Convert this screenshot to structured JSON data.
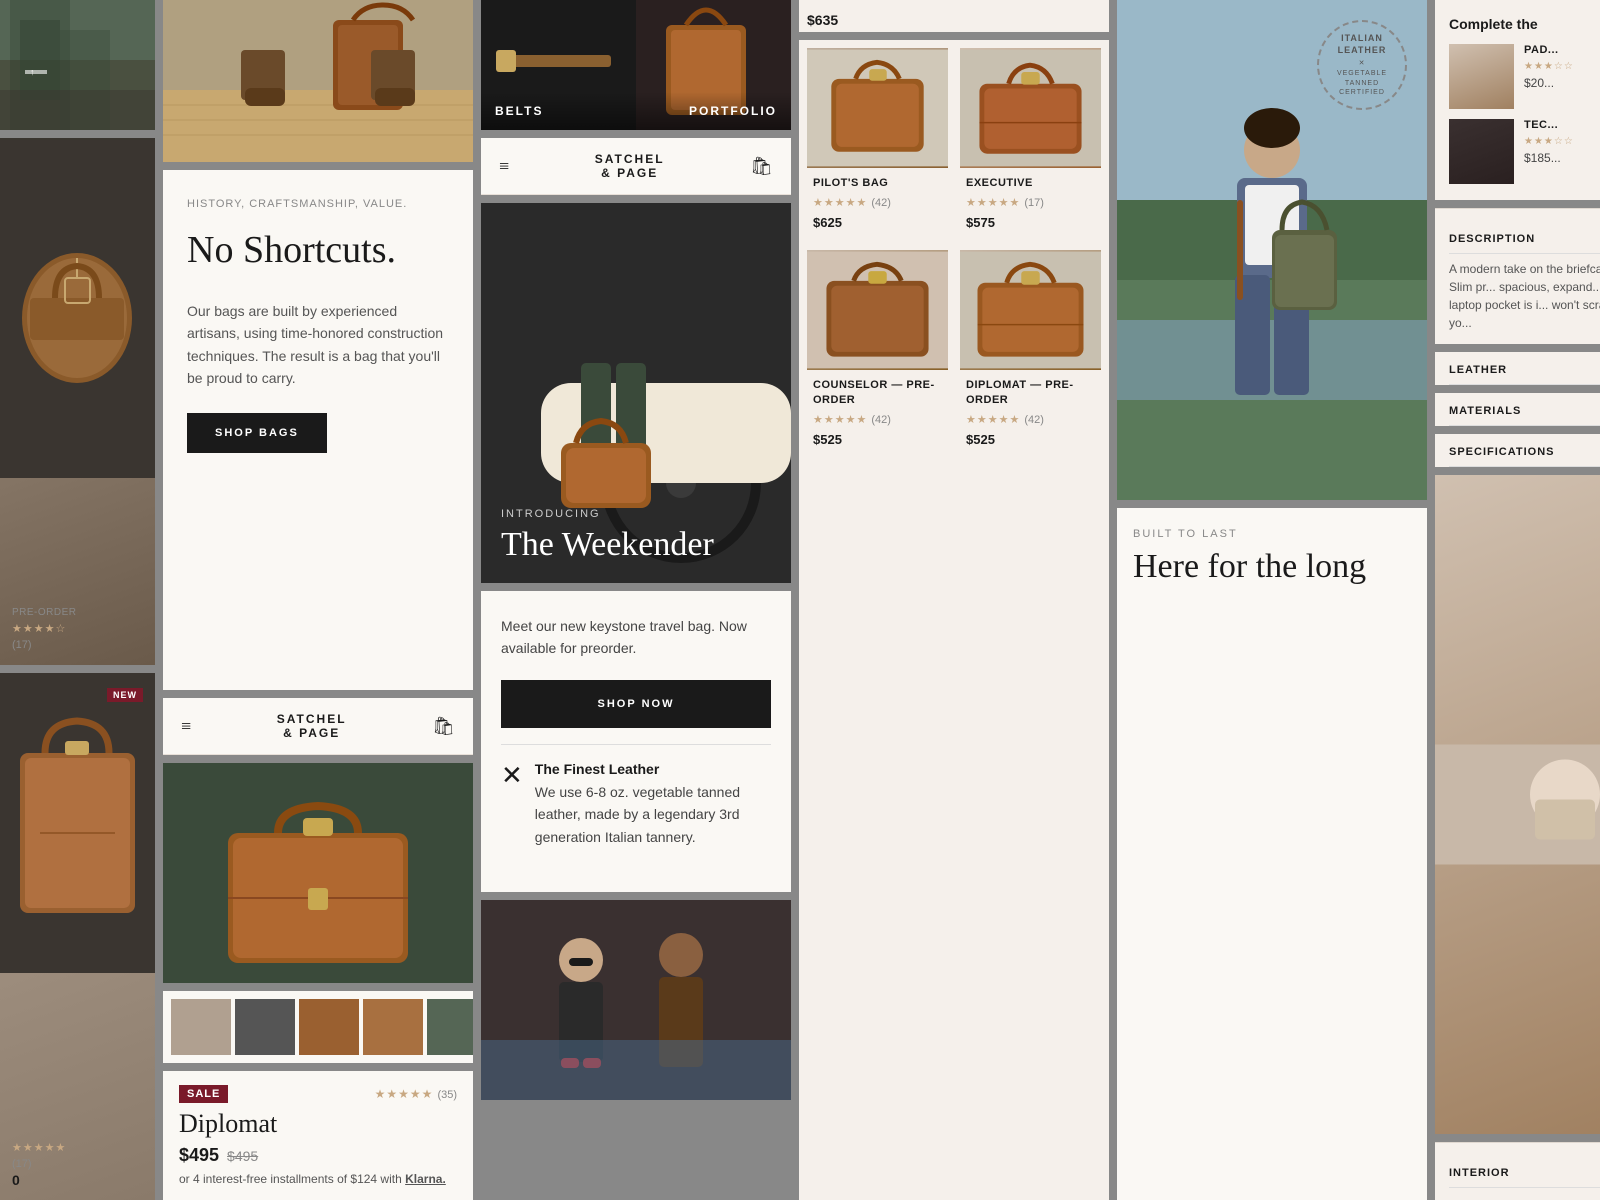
{
  "brand": {
    "name": "SATCHEL",
    "name2": "& PAGE",
    "logo_alt": "Satchel & Page"
  },
  "col1": {
    "street_photo_alt": "Street scene",
    "bag1_alt": "Brown leather bag",
    "pre_order_label": "PRE-ORDER",
    "stars": "★★★★☆",
    "rating_count": "(17)",
    "bag2_alt": "Brown leather briefcase",
    "new_badge": "NEW",
    "stars2": "★★★★★",
    "rating2_count": "(17)",
    "price_label": "0"
  },
  "col2": {
    "photo_alt": "Legs and leather bag",
    "tagline": "HISTORY, CRAFTSMANSHIP, VALUE.",
    "headline": "No Shortcuts.",
    "body": "Our bags are built by experienced artisans, using time-honored construction techniques. The result is a bag that you'll be proud to carry.",
    "shop_bags_label": "SHOP BAGS"
  },
  "col3": {
    "nav": {
      "hamburger": "≡",
      "bag_icon": "🛍",
      "logo_line1": "SATCHEL",
      "logo_line2": "& PAGE"
    },
    "belts_label": "BELTS",
    "portfolio_label": "PORTFOLIO",
    "intro_label": "INTRODUCING",
    "intro_title": "The Weekender",
    "meet_text": "Meet our new keystone travel bag. Now available for preorder.",
    "shop_now_label": "SHOP NOW",
    "feature_icon": "✕",
    "feature_name": "The Finest Leather",
    "feature_desc": "We use 6-8 oz. vegetable tanned leather, made by a legendary 3rd generation Italian tannery.",
    "people_photo_alt": "People street style"
  },
  "col4": {
    "products": [
      {
        "name": "PILOT'S BAG",
        "stars": "★★★★★",
        "rating": "(42)",
        "price": "$625"
      },
      {
        "name": "EXECUTIVE",
        "stars": "★★★★★",
        "rating": "(17)",
        "price": "$575"
      },
      {
        "name": "COUNSELOR — PRE-ORDER",
        "stars": "★★★★★",
        "rating": "(42)",
        "price": "$525"
      },
      {
        "name": "DIPLOMAT — PRE-ORDER",
        "stars": "★★★★★",
        "rating": "(42)",
        "price": "$525"
      }
    ],
    "price_top": "$635"
  },
  "col5": {
    "stamp_text": "ITALIAN LEATHER",
    "stamp_sub": "VEGETABLE TANNED",
    "stamp_cert": "CERTIFIED",
    "photo_alt": "Man with bag outdoors",
    "built_label": "BUILT TO LAST",
    "here_headline": "Here for the long"
  },
  "col6": {
    "complete_label": "Complete the",
    "items": [
      {
        "name": "PAD...",
        "stars": "★★★☆☆",
        "price": "$20..."
      },
      {
        "name": "TEC...",
        "stars": "★★★☆☆",
        "price": "$185..."
      }
    ],
    "description_label": "DESCRIPTION",
    "description_text": "A modern take on the briefcase. Slim pr... spacious, expand... laptop pocket is i... won't scratch yo...",
    "leather_label": "LEATHER",
    "materials_label": "MATERIALS",
    "specifications_label": "SPECIFICATIONS",
    "interior_label": "INTERIOR"
  },
  "col2b": {
    "nav": {
      "hamburger": "≡",
      "logo_line1": "SATCHEL",
      "logo_line2": "& PAGE",
      "bag_icon": "🛍"
    },
    "sale_badge": "SALE",
    "rating_stars": "★★★★★",
    "rating_count": "(35)",
    "product_name": "Diplomat",
    "price_new": "$495",
    "price_old": "$495",
    "installment_text": "or 4 interest-free installments of $124 with",
    "klarna_label": "Klarna.",
    "thumb_alts": [
      "brown bag 1",
      "man with bag",
      "briefcase",
      "brown bag 2",
      "green bag"
    ]
  }
}
